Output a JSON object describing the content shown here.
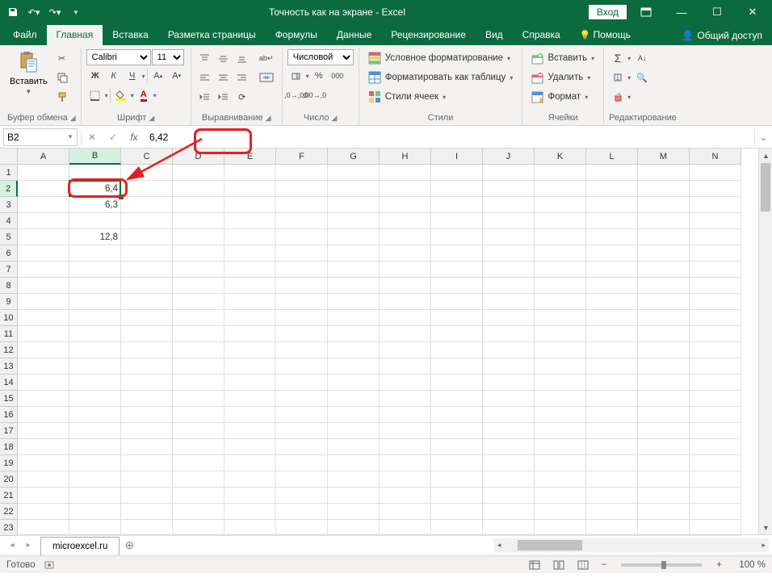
{
  "title": "Точность как на экране  -  Excel",
  "login": "Вход",
  "tabs": [
    "Файл",
    "Главная",
    "Вставка",
    "Разметка страницы",
    "Формулы",
    "Данные",
    "Рецензирование",
    "Вид",
    "Справка",
    "Помощь"
  ],
  "active_tab": 1,
  "share": "Общий доступ",
  "ribbon": {
    "clipboard": {
      "paste": "Вставить",
      "label": "Буфер обмена"
    },
    "font": {
      "name": "Calibri",
      "size": "11",
      "label": "Шрифт"
    },
    "align": {
      "label": "Выравнивание"
    },
    "number": {
      "format": "Числовой",
      "label": "Число"
    },
    "styles": {
      "cond": "Условное форматирование",
      "table": "Форматировать как таблицу",
      "cell": "Стили ячеек",
      "label": "Стили"
    },
    "cells": {
      "insert": "Вставить",
      "delete": "Удалить",
      "format": "Формат",
      "label": "Ячейки"
    },
    "editing": {
      "label": "Редактирование"
    }
  },
  "namebox": "B2",
  "formula": "6,42",
  "columns": [
    "A",
    "B",
    "C",
    "D",
    "E",
    "F",
    "G",
    "H",
    "I",
    "J",
    "K",
    "L",
    "M",
    "N"
  ],
  "rows": 23,
  "sel_col": 1,
  "sel_row": 1,
  "data": {
    "B2": "6,4",
    "B3": "6,3",
    "B5": "12,8"
  },
  "sheet": "microexcel.ru",
  "status": "Готово",
  "zoom": "100 %"
}
